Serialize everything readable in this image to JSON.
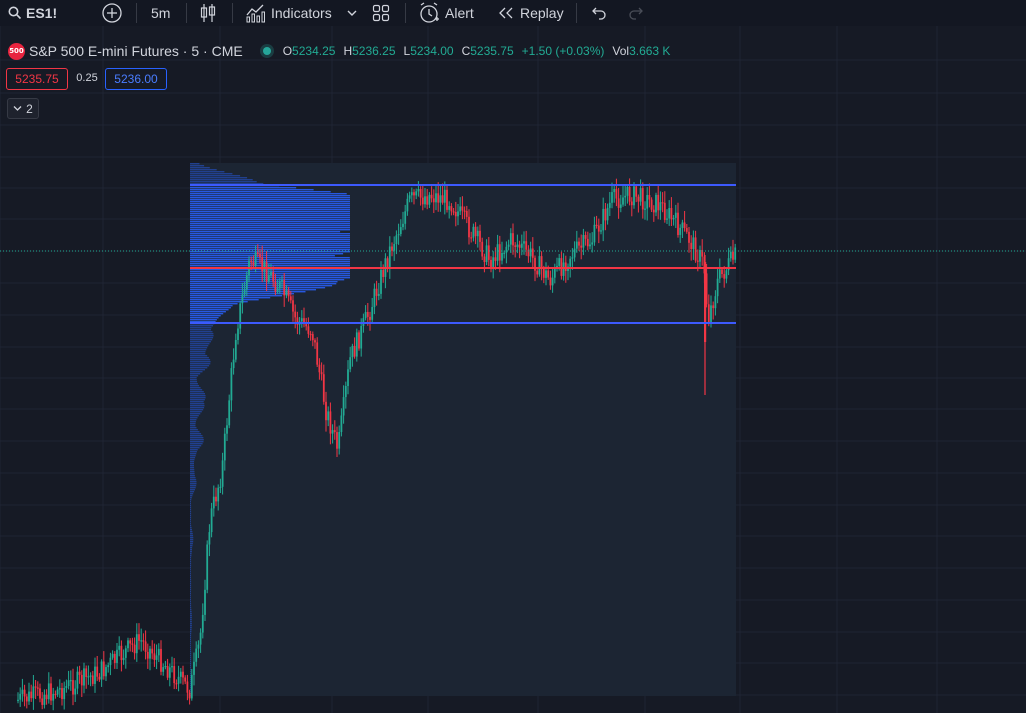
{
  "toolbar": {
    "symbol": "ES1!",
    "interval": "5m",
    "indicators": "Indicators",
    "alert": "Alert",
    "replay": "Replay",
    "icons": [
      "search-icon",
      "add-symbol-icon",
      "candles-icon",
      "indicators-icon",
      "chevron-down-icon",
      "layout-icon",
      "alert-icon",
      "replay-icon",
      "undo-icon",
      "redo-icon"
    ]
  },
  "legend": {
    "logo_text": "500",
    "title": "S&P 500 E-mini Futures · 5 · CME",
    "ohlc": {
      "o_label": "O",
      "o": "5234.25",
      "h_label": "H",
      "h": "5236.25",
      "l_label": "L",
      "l": "5234.00",
      "c_label": "C",
      "c": "5235.75",
      "change": "+1.50 (+0.03%)",
      "vol_label": "Vol",
      "vol": "3.663 K"
    }
  },
  "trade": {
    "sell": "5235.75",
    "spread": "0.25",
    "buy": "5236.00"
  },
  "collapse": {
    "count": "2"
  },
  "colors": {
    "background": "#161a25",
    "up": "#22ab94",
    "down": "#f23645",
    "profile": "#2962ff",
    "value_area_line": "#3d5afe",
    "poc_line": "#f23645"
  }
}
